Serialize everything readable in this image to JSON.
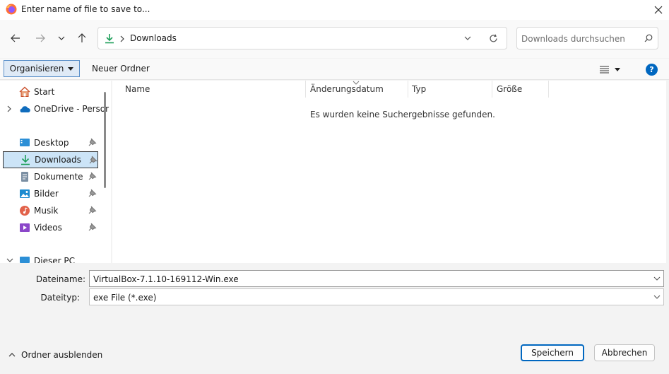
{
  "window": {
    "title": "Enter name of file to save to..."
  },
  "address": {
    "location": "Downloads",
    "search_placeholder": "Downloads durchsuchen"
  },
  "toolbar": {
    "organize_label": "Organisieren",
    "new_folder_label": "Neuer Ordner"
  },
  "sidebar": {
    "items": [
      {
        "label": "Start",
        "icon": "home-icon"
      },
      {
        "label": "OneDrive - Persor",
        "icon": "cloud-icon"
      },
      {
        "label": "Desktop",
        "icon": "desktop-icon",
        "pinned": true
      },
      {
        "label": "Downloads",
        "icon": "download-icon",
        "pinned": true,
        "selected": true
      },
      {
        "label": "Dokumente",
        "icon": "document-icon",
        "pinned": true
      },
      {
        "label": "Bilder",
        "icon": "pictures-icon",
        "pinned": true
      },
      {
        "label": "Musik",
        "icon": "music-icon",
        "pinned": true
      },
      {
        "label": "Videos",
        "icon": "video-icon",
        "pinned": true
      },
      {
        "label": "Dieser PC",
        "icon": "computer-icon"
      }
    ]
  },
  "columns": [
    "Name",
    "Änderungsdatum",
    "Typ",
    "Größe"
  ],
  "empty_message": "Es wurden keine Suchergebnisse gefunden.",
  "form": {
    "filename_label": "Dateiname:",
    "filename_value": "VirtualBox-7.1.10-169112-Win.exe",
    "filetype_label": "Dateityp:",
    "filetype_value": "exe File (*.exe)"
  },
  "footer": {
    "hide_folders_label": "Ordner ausblenden",
    "save_label": "Speichern",
    "cancel_label": "Abbrechen"
  },
  "colors": {
    "accent": "#0067c0",
    "selection": "#cce4f7",
    "download_green": "#1e9f5a"
  }
}
